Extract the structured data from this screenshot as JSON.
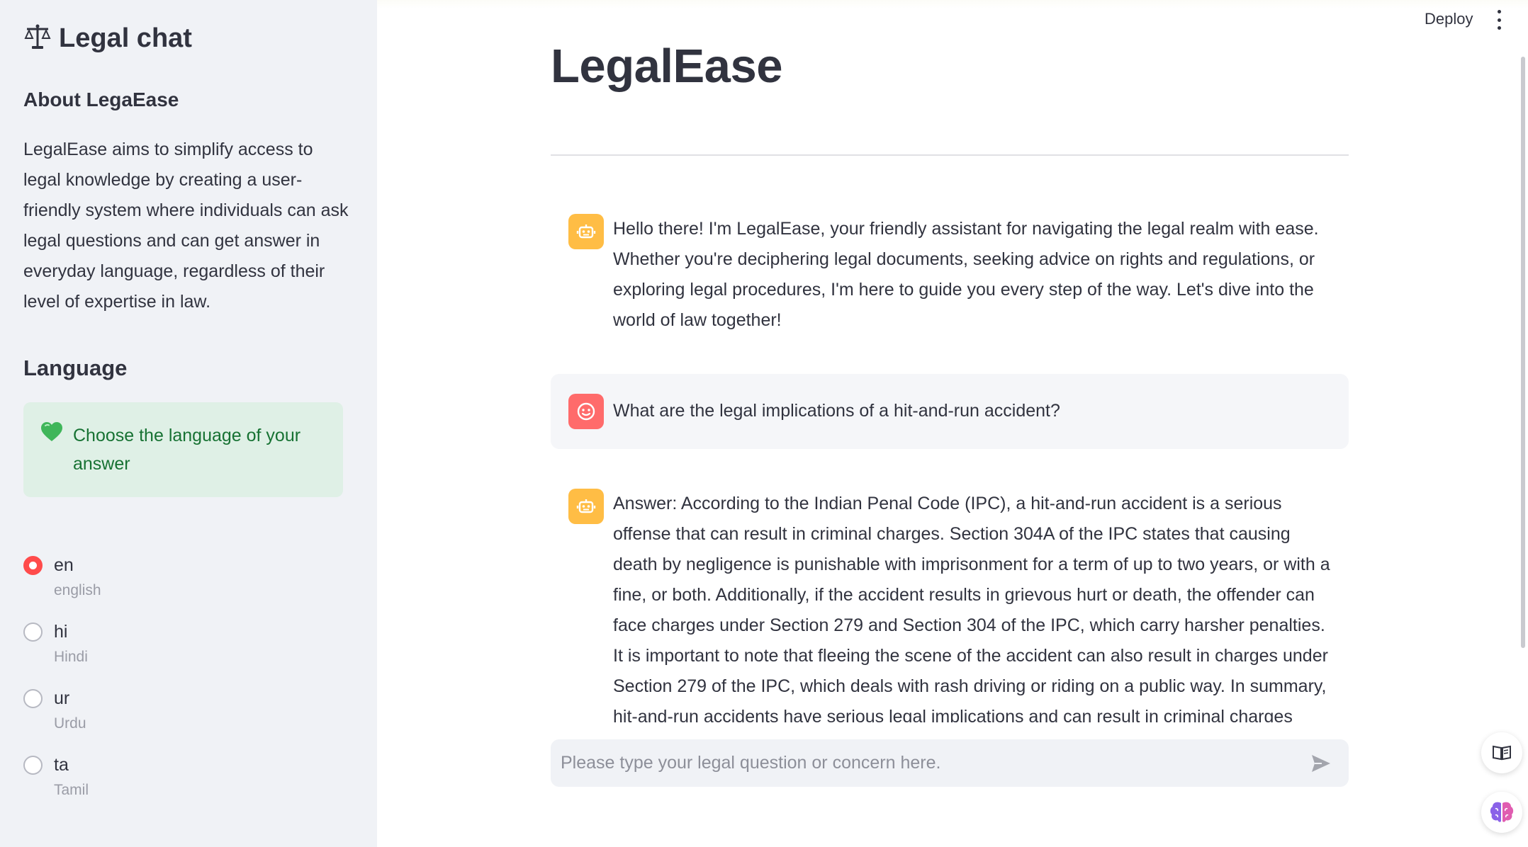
{
  "sidebar": {
    "brand": {
      "icon": "scales-icon",
      "title": "Legal chat"
    },
    "about_heading": "About LegaEase",
    "about_text": "LegalEase aims to simplify access to legal knowledge by creating a user-friendly system where individuals can ask legal questions and can get answer in everyday language, regardless of their level of expertise in law.",
    "language_heading": "Language",
    "info_box": {
      "icon": "green-heart-icon",
      "text": "Choose the language of your answer"
    },
    "languages": [
      {
        "code": "en",
        "name": "english",
        "checked": true
      },
      {
        "code": "hi",
        "name": "Hindi",
        "checked": false
      },
      {
        "code": "ur",
        "name": "Urdu",
        "checked": false
      },
      {
        "code": "ta",
        "name": "Tamil",
        "checked": false
      }
    ]
  },
  "header": {
    "deploy_label": "Deploy",
    "menu_icon": "kebab-menu-icon"
  },
  "main": {
    "title": "LegalEase",
    "messages": [
      {
        "role": "assistant",
        "avatar": "robot-icon",
        "text": "Hello there! I'm LegalEase, your friendly assistant for navigating the legal realm with ease. Whether you're deciphering legal documents, seeking advice on rights and regulations, or exploring legal procedures, I'm here to guide you every step of the way. Let's dive into the world of law together!"
      },
      {
        "role": "user",
        "avatar": "smiley-face-icon",
        "text": "What are the legal implications of a hit-and-run accident?"
      },
      {
        "role": "assistant",
        "avatar": "robot-icon",
        "text": "Answer: According to the Indian Penal Code (IPC), a hit-and-run accident is a serious offense that can result in criminal charges. Section 304A of the IPC states that causing death by negligence is punishable with imprisonment for a term of up to two years, or with a fine, or both. Additionally, if the accident results in grievous hurt or death, the offender can face charges under Section 279 and Section 304 of the IPC, which carry harsher penalties. It is important to note that fleeing the scene of the accident can also result in charges under Section 279 of the IPC, which deals with rash driving or riding on a public way. In summary, hit-and-run accidents have serious legal implications and can result in criminal charges under various sections of the IPC."
      }
    ],
    "chat_input": {
      "placeholder": "Please type your legal question or concern here.",
      "value": "",
      "send_icon": "send-arrow-icon"
    }
  },
  "floating_buttons": [
    {
      "icon": "book-open-icon"
    },
    {
      "icon": "brain-icon"
    }
  ],
  "colors": {
    "accent": "#ff4b4b",
    "bot_avatar": "#ffbd45",
    "user_avatar": "#ff6b6b",
    "info_bg": "#dff0e6",
    "info_text": "#177233",
    "sidebar_bg": "#f0f2f6"
  }
}
